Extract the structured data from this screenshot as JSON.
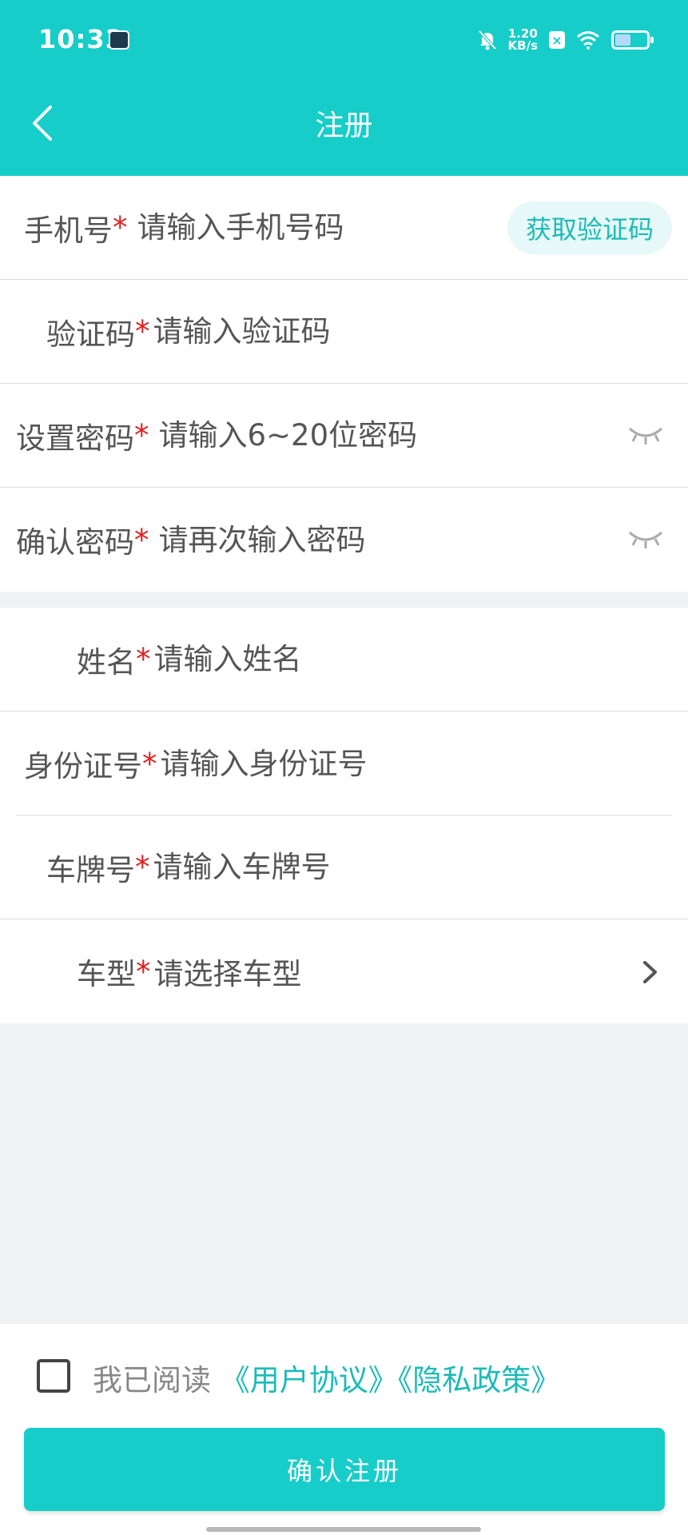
{
  "status_bar": {
    "time": "10:33",
    "speed_value": "1.20",
    "speed_unit": "KB/s",
    "battery_level": 0.45
  },
  "header": {
    "title": "注册",
    "bg_color": "#16cdc9"
  },
  "form": {
    "phone": {
      "label": "手机号",
      "placeholder": "请输入手机号码",
      "get_code": "获取验证码"
    },
    "code": {
      "label": "验证码",
      "placeholder": "请输入验证码"
    },
    "password": {
      "label": "设置密码",
      "placeholder": "请输入6~20位密码"
    },
    "confirm_password": {
      "label": "确认密码",
      "placeholder": "请再次输入密码"
    },
    "name": {
      "label": "姓名",
      "placeholder": "请输入姓名"
    },
    "id_number": {
      "label": "身份证号",
      "placeholder": "请输入身份证号"
    },
    "plate": {
      "label": "车牌号",
      "placeholder": "请输入车牌号"
    },
    "car_type": {
      "label": "车型",
      "placeholder": "请选择车型"
    },
    "required_mark": "*"
  },
  "agreement": {
    "prefix": "我已阅读",
    "user_agreement": "《用户协议》",
    "privacy_policy": "《隐私政策》"
  },
  "submit_label": "确认注册"
}
